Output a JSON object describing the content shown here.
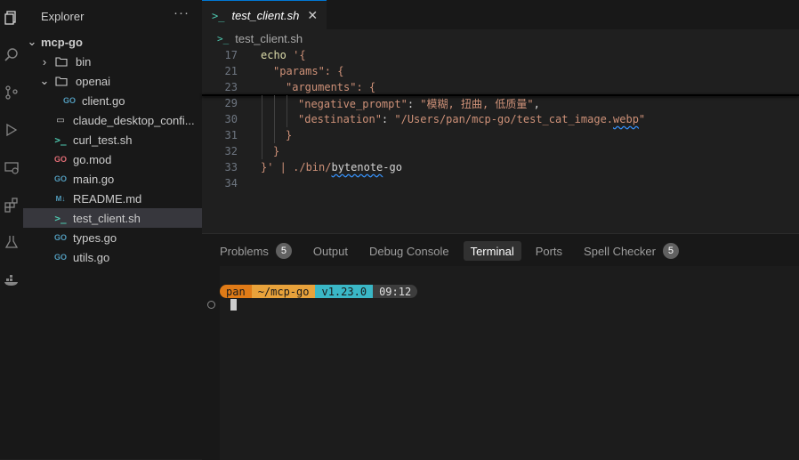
{
  "sidebar": {
    "title": "Explorer",
    "more": "···",
    "root": "mcp-go",
    "items": [
      {
        "label": "bin",
        "type": "folder"
      },
      {
        "label": "openai",
        "type": "folder"
      },
      {
        "label": "client.go",
        "type": "go"
      },
      {
        "label": "claude_desktop_confi...",
        "type": "json"
      },
      {
        "label": "curl_test.sh",
        "type": "sh"
      },
      {
        "label": "go.mod",
        "type": "mod"
      },
      {
        "label": "main.go",
        "type": "go"
      },
      {
        "label": "README.md",
        "type": "md"
      },
      {
        "label": "test_client.sh",
        "type": "sh"
      },
      {
        "label": "types.go",
        "type": "go"
      },
      {
        "label": "utils.go",
        "type": "go"
      }
    ]
  },
  "editor": {
    "tab_label": "test_client.sh",
    "breadcrumb": "test_client.sh",
    "lines": [
      {
        "n": "17",
        "text": "echo '{"
      },
      {
        "n": "21",
        "text": "\"params\": {"
      },
      {
        "n": "23",
        "text": "\"arguments\": {"
      },
      {
        "n": "29",
        "key": "\"negative_prompt\"",
        "val": "\"模糊, 扭曲, 低质量\""
      },
      {
        "n": "30",
        "key": "\"destination\"",
        "val": "\"/Users/pan/mcp-go/test_cat_image.",
        "val2": "webp",
        "val3": "\""
      },
      {
        "n": "31",
        "text": "}"
      },
      {
        "n": "32",
        "text": "}"
      },
      {
        "n": "33",
        "pre": "}' | ./bin/",
        "cmd": "bytenote",
        "post": "-go"
      },
      {
        "n": "34",
        "text": ""
      }
    ]
  },
  "panel": {
    "tabs": [
      {
        "label": "Problems",
        "badge": "5"
      },
      {
        "label": "Output"
      },
      {
        "label": "Debug Console"
      },
      {
        "label": "Terminal",
        "active": true
      },
      {
        "label": "Ports"
      },
      {
        "label": "Spell Checker",
        "badge": "5"
      }
    ],
    "prompt": {
      "user": " pan",
      "path": "~/mcp-go",
      "go": " v1.23.0",
      "time": " 09:12"
    }
  }
}
